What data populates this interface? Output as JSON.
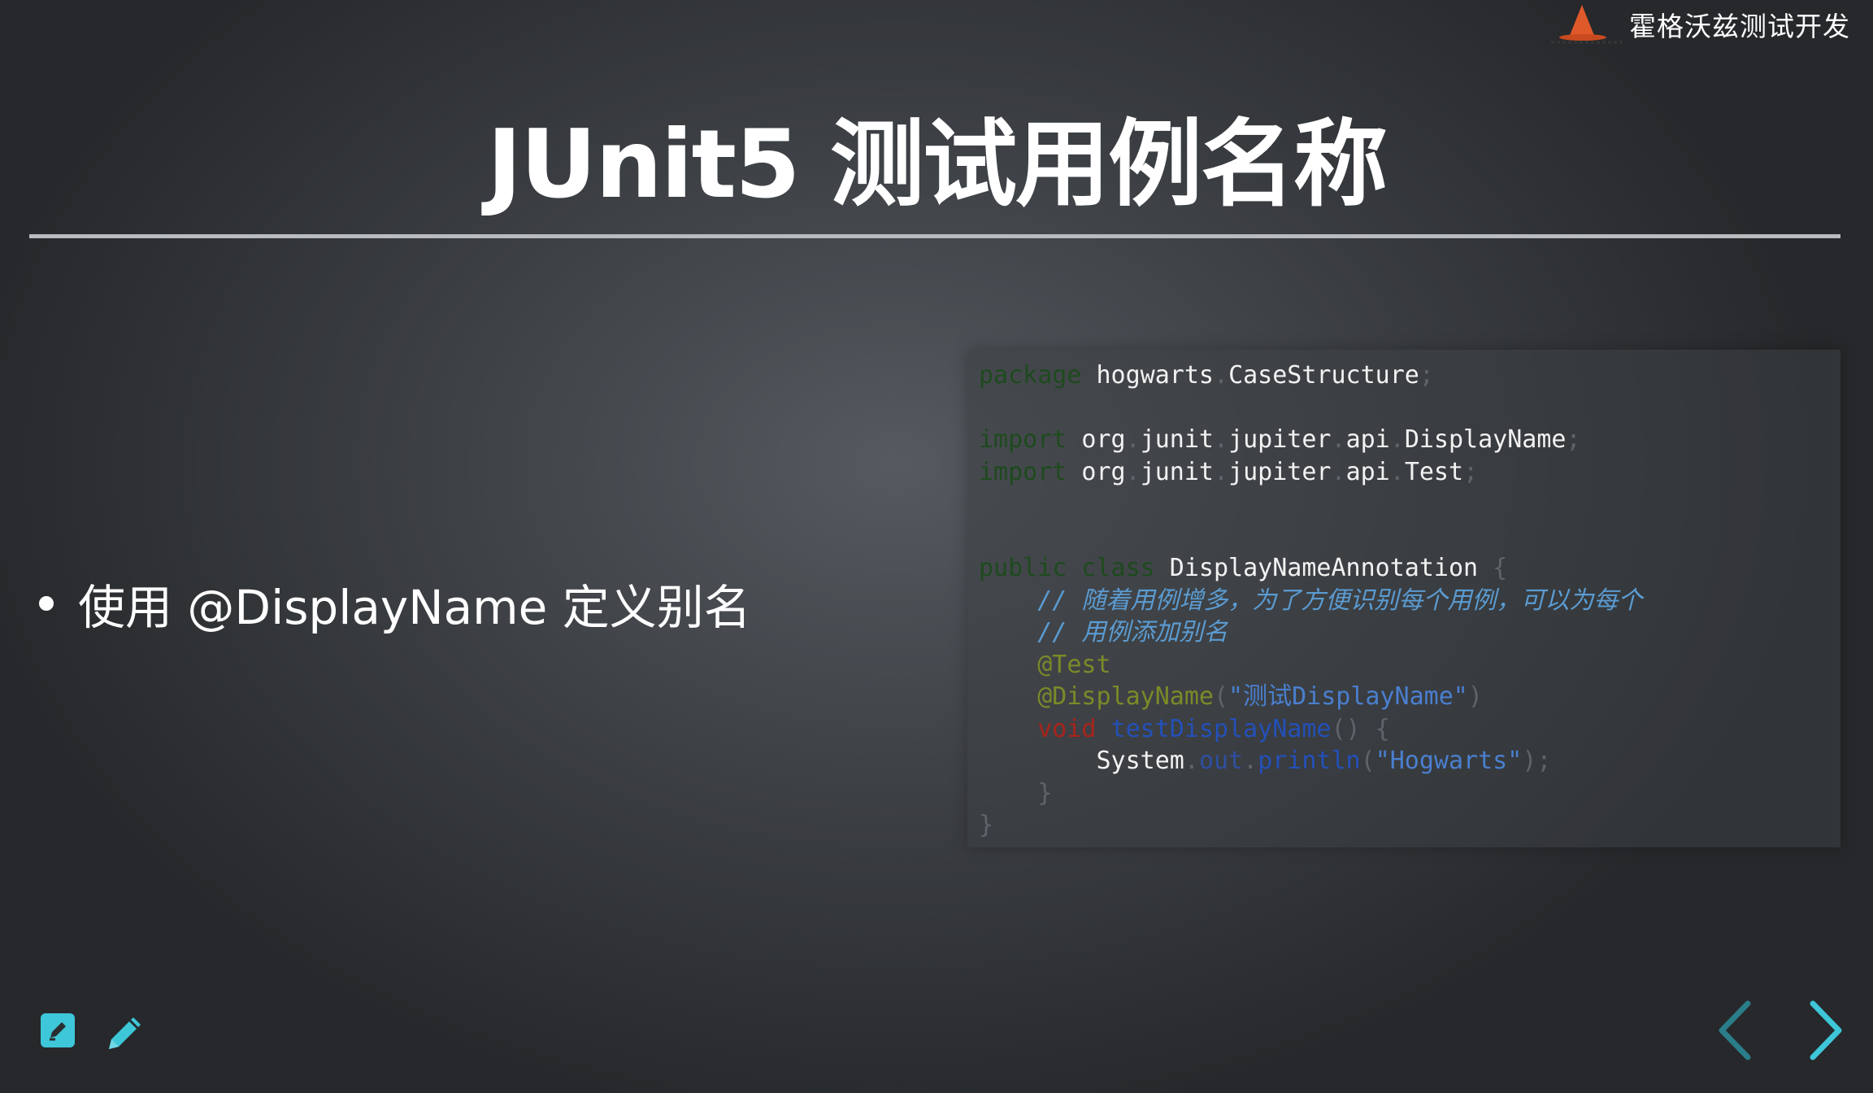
{
  "brand": {
    "name": "霍格沃兹测试开发",
    "logo_icon": "wizard-hat-logo-icon"
  },
  "slide": {
    "title": "JUnit5 测试用例名称",
    "bullets": [
      "使用 @DisplayName 定义别名"
    ]
  },
  "code": {
    "language": "java",
    "lines": [
      [
        {
          "t": "kw-dim",
          "v": "package"
        },
        {
          "t": "ident",
          "v": " hogwarts"
        },
        {
          "t": "punct",
          "v": "."
        },
        {
          "t": "ident",
          "v": "CaseStructure"
        },
        {
          "t": "punct",
          "v": ";"
        }
      ],
      [],
      [
        {
          "t": "kw-dim",
          "v": "import"
        },
        {
          "t": "ident",
          "v": " org"
        },
        {
          "t": "punct",
          "v": "."
        },
        {
          "t": "ident",
          "v": "junit"
        },
        {
          "t": "punct",
          "v": "."
        },
        {
          "t": "ident",
          "v": "jupiter"
        },
        {
          "t": "punct",
          "v": "."
        },
        {
          "t": "ident",
          "v": "api"
        },
        {
          "t": "punct",
          "v": "."
        },
        {
          "t": "ident",
          "v": "DisplayName"
        },
        {
          "t": "punct",
          "v": ";"
        }
      ],
      [
        {
          "t": "kw-dim",
          "v": "import"
        },
        {
          "t": "ident",
          "v": " org"
        },
        {
          "t": "punct",
          "v": "."
        },
        {
          "t": "ident",
          "v": "junit"
        },
        {
          "t": "punct",
          "v": "."
        },
        {
          "t": "ident",
          "v": "jupiter"
        },
        {
          "t": "punct",
          "v": "."
        },
        {
          "t": "ident",
          "v": "api"
        },
        {
          "t": "punct",
          "v": "."
        },
        {
          "t": "ident",
          "v": "Test"
        },
        {
          "t": "punct",
          "v": ";"
        }
      ],
      [],
      [],
      [
        {
          "t": "kw-dim",
          "v": "public class"
        },
        {
          "t": "ident",
          "v": " DisplayNameAnnotation"
        },
        {
          "t": "punct",
          "v": " {"
        }
      ],
      [
        {
          "t": "comment",
          "v": "    // 随着用例增多，为了方便识别每个用例，可以为每个"
        }
      ],
      [
        {
          "t": "comment",
          "v": "    // 用例添加别名"
        }
      ],
      [
        {
          "t": "annot",
          "v": "    @Test"
        }
      ],
      [
        {
          "t": "annot",
          "v": "    @DisplayName"
        },
        {
          "t": "punct",
          "v": "("
        },
        {
          "t": "str",
          "v": "\"测试DisplayName\""
        },
        {
          "t": "punct",
          "v": ")"
        }
      ],
      [
        {
          "t": "kw-void",
          "v": "    void"
        },
        {
          "t": "method",
          "v": " testDisplayName"
        },
        {
          "t": "punct",
          "v": "() {"
        }
      ],
      [
        {
          "t": "ident",
          "v": "        System"
        },
        {
          "t": "punct",
          "v": "."
        },
        {
          "t": "field",
          "v": "out"
        },
        {
          "t": "punct",
          "v": "."
        },
        {
          "t": "method",
          "v": "println"
        },
        {
          "t": "punct",
          "v": "("
        },
        {
          "t": "str",
          "v": "\"Hogwarts\""
        },
        {
          "t": "punct",
          "v": ");"
        }
      ],
      [
        {
          "t": "punct",
          "v": "    }"
        }
      ],
      [
        {
          "t": "punct",
          "v": "}"
        }
      ]
    ]
  },
  "controls": {
    "left_icons": [
      "edit-square-icon",
      "pencil-icon"
    ],
    "nav": [
      "prev-arrow-icon",
      "next-arrow-icon"
    ],
    "accent_color": "#3ec6d9",
    "dim_accent_color": "#2a7d89"
  }
}
